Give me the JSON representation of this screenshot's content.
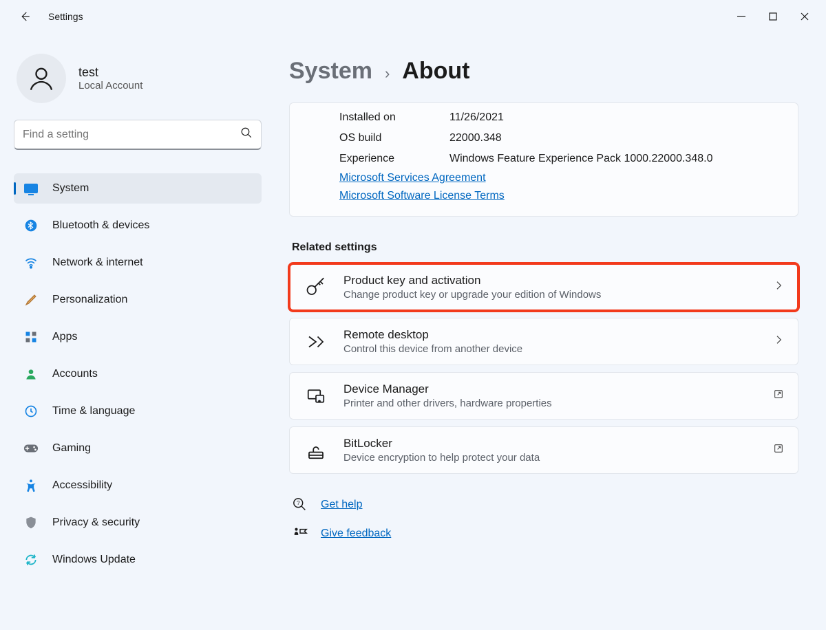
{
  "titlebar": {
    "app_name": "Settings"
  },
  "profile": {
    "name": "test",
    "role": "Local Account"
  },
  "search": {
    "placeholder": "Find a setting"
  },
  "nav": {
    "items": [
      {
        "label": "System"
      },
      {
        "label": "Bluetooth & devices"
      },
      {
        "label": "Network & internet"
      },
      {
        "label": "Personalization"
      },
      {
        "label": "Apps"
      },
      {
        "label": "Accounts"
      },
      {
        "label": "Time & language"
      },
      {
        "label": "Gaming"
      },
      {
        "label": "Accessibility"
      },
      {
        "label": "Privacy & security"
      },
      {
        "label": "Windows Update"
      }
    ]
  },
  "breadcrumb": {
    "parent": "System",
    "separator": "›",
    "current": "About"
  },
  "specs_card": {
    "rows": [
      {
        "key": "Installed on",
        "value": "11/26/2021"
      },
      {
        "key": "OS build",
        "value": "22000.348"
      },
      {
        "key": "Experience",
        "value": "Windows Feature Experience Pack 1000.22000.348.0"
      }
    ],
    "links": [
      "Microsoft Services Agreement",
      "Microsoft Software License Terms"
    ]
  },
  "related": {
    "header": "Related settings",
    "items": [
      {
        "title": "Product key and activation",
        "subtitle": "Change product key or upgrade your edition of Windows",
        "action": "chevron",
        "icon": "key",
        "highlight": true
      },
      {
        "title": "Remote desktop",
        "subtitle": "Control this device from another device",
        "action": "chevron",
        "icon": "remote",
        "highlight": false
      },
      {
        "title": "Device Manager",
        "subtitle": "Printer and other drivers, hardware properties",
        "action": "open",
        "icon": "device",
        "highlight": false
      },
      {
        "title": "BitLocker",
        "subtitle": "Device encryption to help protect your data",
        "action": "open",
        "icon": "lock",
        "highlight": false
      }
    ]
  },
  "footer": {
    "help": "Get help",
    "feedback": "Give feedback"
  }
}
